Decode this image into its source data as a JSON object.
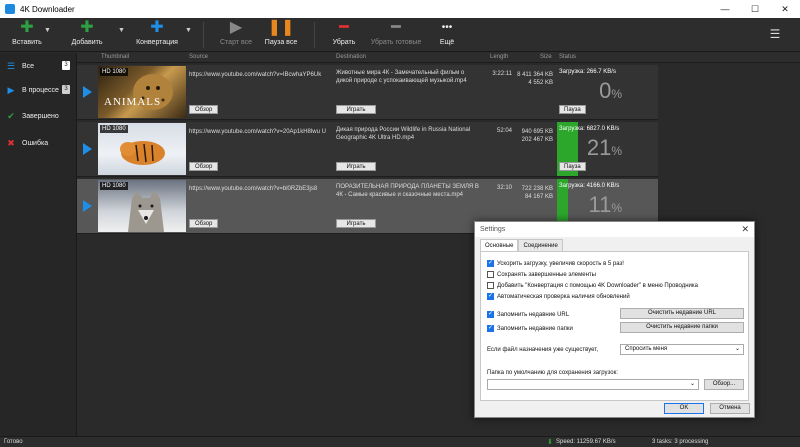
{
  "window": {
    "title": "4K Downloader",
    "minimize": "—",
    "maximize": "☐",
    "close": "✕"
  },
  "toolbar": {
    "paste": "Вставить",
    "add": "Добавить",
    "convert": "Конвертация",
    "start_all": "Старт все",
    "pause_all": "Пауза все",
    "remove": "Убрать",
    "remove_done": "Убрать готовые",
    "more": "Ещё",
    "more_glyph": "•••",
    "dropdown_glyph": "▼"
  },
  "sidebar": {
    "items": [
      {
        "label": "Все",
        "count": "3",
        "icon": "list-icon"
      },
      {
        "label": "В процессе",
        "count": "3",
        "icon": "play-icon"
      },
      {
        "label": "Завершено",
        "count": "",
        "icon": "check-icon"
      },
      {
        "label": "Ошибка",
        "count": "",
        "icon": "error-x-icon"
      }
    ]
  },
  "columns": [
    "Thumbnail",
    "Source",
    "Destination",
    "Length",
    "Size",
    "Status"
  ],
  "rows": [
    {
      "quality": "HD 1080",
      "thumb_text": "ANIMALS",
      "url": "https://www.youtube.com/watch?v=IBcwhaYP6Uk",
      "destination": "Животные мира 4К - Замечательный фильм о дикой природе с успокаивающей музыкой.mp4",
      "length": "3:22:11",
      "size_total": "8 411 364 KB",
      "size_done": "4 552 KB",
      "status_text": "Загрузка: 266.7 KB/s",
      "percent": 0,
      "percent_text": "0",
      "browse": "Обзор",
      "play": "Играть",
      "pause": "Пауза"
    },
    {
      "quality": "HD 1080",
      "thumb_text": "",
      "url": "https://www.youtube.com/watch?v=20Ap1kH8lwu U",
      "destination": "Дикая природа  России   Wildlife in Russia National Geographic 4K Ultra HD.mp4",
      "length": "52:04",
      "size_total": "940 695 KB",
      "size_done": "202 467 KB",
      "status_text": "Загрузка: 6827.0 KB/s",
      "percent": 21,
      "percent_text": "21",
      "browse": "Обзор",
      "play": "Играть",
      "pause": "Пауза"
    },
    {
      "quality": "HD 1080",
      "thumb_text": "",
      "url": "https://www.youtube.com/watch?v=bl0RZbE3js8",
      "destination": "ПОРАЗИТЕЛЬНАЯ ПРИРОДА ПЛАНЕТЫ ЗЕМЛЯ В 4К - Самые красивые и сказочные места.mp4",
      "length": "32:10",
      "size_total": "722 238 KB",
      "size_done": "84 167 KB",
      "status_text": "Загрузка: 4166.0 KB/s",
      "percent": 11,
      "percent_text": "11",
      "browse": "Обзор",
      "play": "Играть",
      "pause": ""
    }
  ],
  "percent_sign": "%",
  "settings": {
    "title": "Settings",
    "close": "✕",
    "tabs": [
      "Основные",
      "Соединение"
    ],
    "checkboxes": [
      {
        "label": "Ускорить загрузку, увеличив скорость в 5 раз!",
        "checked": true
      },
      {
        "label": "Сохранять завершенные элементы",
        "checked": false
      },
      {
        "label": "Добавить \"Конвертация с помощью 4K Downloader\" в меню Проводника",
        "checked": false
      },
      {
        "label": "Автоматическая проверка наличия обновлений",
        "checked": true
      },
      {
        "label": "Запомнить недавние URL",
        "checked": true
      },
      {
        "label": "Запомнить недавние папки",
        "checked": true
      }
    ],
    "clear_urls": "Очистить недавние URL",
    "clear_folders": "Очистить недавние папки",
    "if_exists_label": "Если файл назначения уже существует,",
    "if_exists_value": "Спросить меня",
    "default_folder_label": "Папка по умолчанию для сохранения загрузок:",
    "default_folder_value": "",
    "browse": "Обзор...",
    "ok": "OK",
    "cancel": "Отмена"
  },
  "statusbar": {
    "ready": "Готово",
    "speed": "Speed: 11259.67 KB/s",
    "tasks": "3 tasks: 3 processing"
  },
  "colors": {
    "accent": "#1e8ee6",
    "progress": "#2ca72c",
    "add_green": "#2ea043",
    "pause_orange": "#e8871e",
    "remove_red": "#e03030"
  }
}
